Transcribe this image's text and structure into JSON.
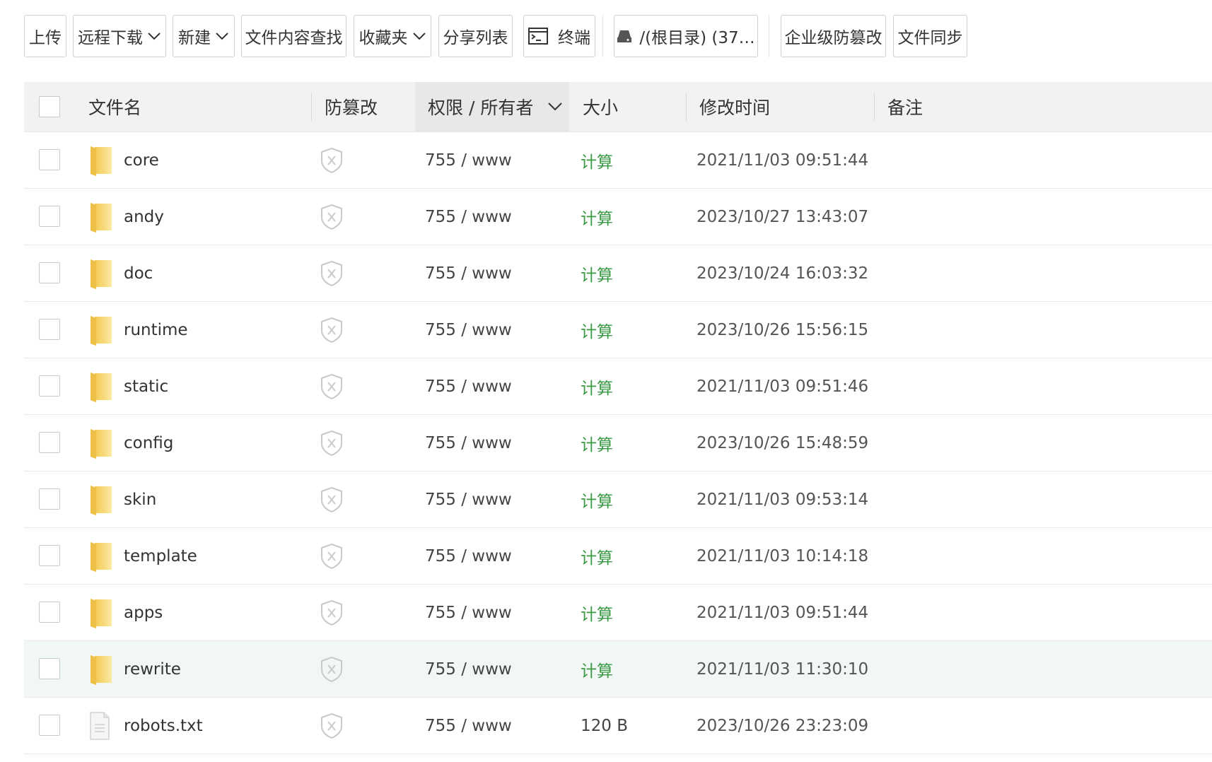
{
  "toolbar": {
    "upload": "上传",
    "remote_download": "远程下载",
    "new": "新建",
    "content_search": "文件内容查找",
    "favorites": "收藏夹",
    "share_list": "分享列表",
    "terminal": "终端",
    "disk": "/(根目录) (37…",
    "enterprise_tamper": "企业级防篡改",
    "file_sync": "文件同步"
  },
  "table": {
    "headers": {
      "filename": "文件名",
      "tamper": "防篡改",
      "perm_owner": "权限 / 所有者",
      "size": "大小",
      "mtime": "修改时间",
      "note": "备注"
    },
    "rows": [
      {
        "name": "core",
        "type": "folder",
        "perm": "755 / www",
        "size": "计算",
        "mtime": "2021/11/03 09:51:44"
      },
      {
        "name": "andy",
        "type": "folder",
        "perm": "755 / www",
        "size": "计算",
        "mtime": "2023/10/27 13:43:07"
      },
      {
        "name": "doc",
        "type": "folder",
        "perm": "755 / www",
        "size": "计算",
        "mtime": "2023/10/24 16:03:32"
      },
      {
        "name": "runtime",
        "type": "folder",
        "perm": "755 / www",
        "size": "计算",
        "mtime": "2023/10/26 15:56:15"
      },
      {
        "name": "static",
        "type": "folder",
        "perm": "755 / www",
        "size": "计算",
        "mtime": "2021/11/03 09:51:46"
      },
      {
        "name": "config",
        "type": "folder",
        "perm": "755 / www",
        "size": "计算",
        "mtime": "2023/10/26 15:48:59"
      },
      {
        "name": "skin",
        "type": "folder",
        "perm": "755 / www",
        "size": "计算",
        "mtime": "2021/11/03 09:53:14"
      },
      {
        "name": "template",
        "type": "folder",
        "perm": "755 / www",
        "size": "计算",
        "mtime": "2021/11/03 10:14:18"
      },
      {
        "name": "apps",
        "type": "folder",
        "perm": "755 / www",
        "size": "计算",
        "mtime": "2021/11/03 09:51:44"
      },
      {
        "name": "rewrite",
        "type": "folder",
        "perm": "755 / www",
        "size": "计算",
        "mtime": "2021/11/03 11:30:10"
      },
      {
        "name": "robots.txt",
        "type": "file",
        "perm": "755 / www",
        "size": "120 B",
        "mtime": "2023/10/26 23:23:09"
      }
    ],
    "highlighted_row": "rewrite"
  },
  "colors": {
    "calc_link": "#3a9a44",
    "header_bg": "#f2f2f2",
    "row_highlight": "#f1f7f5"
  },
  "icons": {
    "folder": "folder-icon",
    "file": "text-file-icon",
    "tamper": "shield-x-icon",
    "terminal": "terminal-icon",
    "disk": "hard-drive-icon",
    "dropdown": "chevron-down-icon"
  }
}
